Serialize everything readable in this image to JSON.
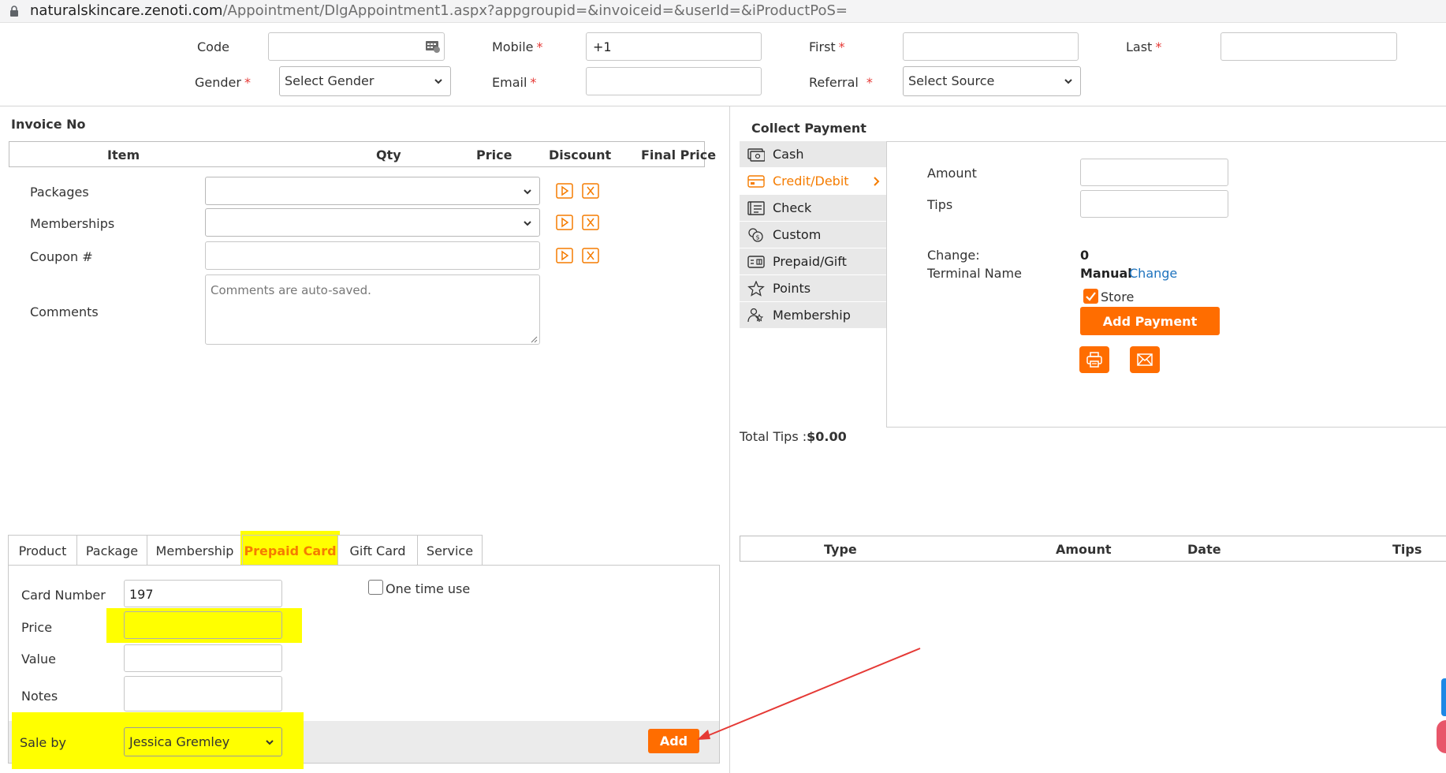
{
  "browser": {
    "url_host": "naturalskincare.zenoti.com",
    "url_path": "/Appointment/DlgAppointment1.aspx?appgroupid=&invoiceid=&userId=&iProductPoS="
  },
  "guest_form": {
    "code_label": "Code",
    "mobile_label": "Mobile",
    "mobile_value": "+1",
    "first_label": "First",
    "last_label": "Last",
    "gender_label": "Gender",
    "gender_value": "Select Gender",
    "email_label": "Email",
    "referral_label": "Referral",
    "referral_value": "Select Source",
    "required_mark": "*"
  },
  "invoice": {
    "title": "Invoice No",
    "columns": [
      "Item",
      "Qty",
      "Price",
      "Discount",
      "Final Price"
    ],
    "rows": [
      {
        "label": "Packages"
      },
      {
        "label": "Memberships"
      },
      {
        "label": "Coupon #"
      }
    ],
    "comments_label": "Comments",
    "comments_placeholder": "Comments are auto-saved."
  },
  "payment": {
    "title": "Collect Payment",
    "methods": [
      {
        "label": "Cash",
        "icon": "cash-icon"
      },
      {
        "label": "Credit/Debit",
        "icon": "credit-card-icon",
        "active": true
      },
      {
        "label": "Check",
        "icon": "check-icon"
      },
      {
        "label": "Custom",
        "icon": "custom-payment-icon"
      },
      {
        "label": "Prepaid/Gift",
        "icon": "gift-card-icon"
      },
      {
        "label": "Points",
        "icon": "star-icon"
      },
      {
        "label": "Membership",
        "icon": "membership-icon"
      }
    ],
    "amount_label": "Amount",
    "tips_label": "Tips",
    "change_label": "Change:",
    "change_value": "0",
    "terminal_label": "Terminal Name",
    "terminal_value": "Manual",
    "change_link": "Change",
    "store_label": "Store",
    "store_checked": true,
    "add_payment_label": "Add Payment",
    "total_tips_label": "Total Tips :",
    "total_tips_value": "$0.00",
    "history_columns": [
      "Type",
      "Amount",
      "Date",
      "Tips"
    ]
  },
  "tabs": {
    "items": [
      "Product",
      "Package",
      "Membership",
      "Prepaid Card",
      "Gift Card",
      "Service"
    ],
    "active": "Prepaid Card"
  },
  "prepaid_form": {
    "card_number_label": "Card Number",
    "card_number_value": "197",
    "one_time_label": "One time use",
    "one_time_checked": false,
    "price_label": "Price",
    "value_label": "Value",
    "notes_label": "Notes",
    "sale_by_label": "Sale by",
    "sale_by_value": "Jessica Gremley",
    "add_label": "Add"
  },
  "colors": {
    "accent": "#ff6d00",
    "highlight": "#ffff00",
    "link": "#1e73be",
    "annotation_arrow": "#e53935"
  }
}
